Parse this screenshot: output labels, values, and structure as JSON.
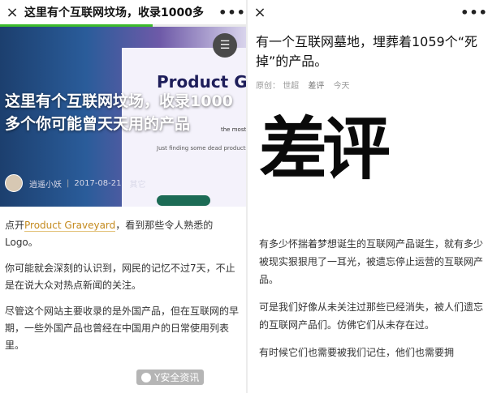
{
  "left": {
    "topbar_title": "这里有个互联网坟场，收录1000多",
    "close_glyph": "×",
    "more_glyph": "•••",
    "reading_progress": 0.62,
    "hero": {
      "title": "这里有个互联网坟场，收录1000多个你可能曾天天用的产品",
      "card_title": "Product Graveyard",
      "card_subtitle": "the most memorable dead products.",
      "card_body": "Just finding some dead products",
      "menu_glyph": "☰"
    },
    "author": "逍遥小妖",
    "date": "2017-08-21",
    "category": "其它",
    "paragraphs": [
      {
        "before": "点开",
        "link": "Product Graveyard",
        "after": "，看到那些令人熟悉的Logo。"
      },
      {
        "text": "你可能就会深刻的认识到，网民的记忆不过7天，不止是在说大众对热点新闻的关注。"
      },
      {
        "text": "尽管这个网站主要收录的是外国产品，但在互联网的早期，一些外国产品也曾经在中国用户的日常使用列表里。"
      }
    ]
  },
  "right": {
    "close_glyph": "×",
    "more_glyph": "•••",
    "title": "有一个互联网墓地，埋葬着1059个“死掉”的产品。",
    "meta_original": "原创：",
    "meta_author": "世超",
    "meta_source": "差评",
    "meta_date": "今天",
    "logo_text": "差评",
    "paragraphs": [
      "有多少怀揣着梦想诞生的互联网产品诞生，就有多少被现实狠狠甩了一耳光，被遗忘停止运营的互联网产品。",
      "可是我们好像从未关注过那些已经消失，被人们遗忘的互联网产品们。仿佛它们从未存在过。",
      "有时候它们也需要被我们记住，他们也需要拥"
    ],
    "watermark": "Y安全资讯"
  }
}
